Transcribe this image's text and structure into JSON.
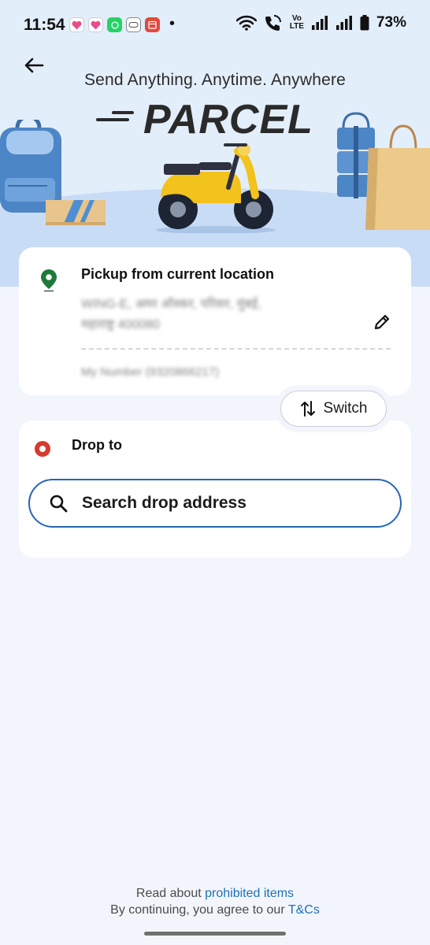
{
  "status_bar": {
    "time": "11:54",
    "notification_icons": [
      "heart-icon",
      "heart-icon",
      "whatsapp-icon",
      "messages-icon",
      "calendar-icon"
    ],
    "more_indicator": "•",
    "volte_label_top": "Vo",
    "volte_label_bottom": "LTE",
    "battery_percent": "73%"
  },
  "header": {
    "back_icon": "arrow-left-icon",
    "tagline": "Send Anything. Anytime. Anywhere",
    "brand": "PARCEL"
  },
  "pickup": {
    "title": "Pickup from current location",
    "address_line1": "WING-E, अमर ऑस्कर, परिसर, मुंबई,",
    "address_line2": "महाराष्ट्र 400080",
    "contact": "My Number (9320866217)",
    "edit_icon": "pencil-icon",
    "pin_icon": "location-pin-icon"
  },
  "switch_button": {
    "label": "Switch",
    "icon": "swap-vertical-icon"
  },
  "drop": {
    "title": "Drop to",
    "search_placeholder": "Search drop address",
    "search_icon": "search-icon"
  },
  "footer": {
    "line1_prefix": "Read about ",
    "line1_link": "prohibited items",
    "line2_prefix": "By continuing, you agree to our ",
    "line2_link": "T&Cs"
  },
  "colors": {
    "accent": "#2865b8",
    "link": "#1e6fb8",
    "drop_marker": "#d63a2e",
    "pickup_marker": "#1f7a3a",
    "hero_bg": "#e3eefb",
    "page_bg": "#f2f6fc"
  }
}
